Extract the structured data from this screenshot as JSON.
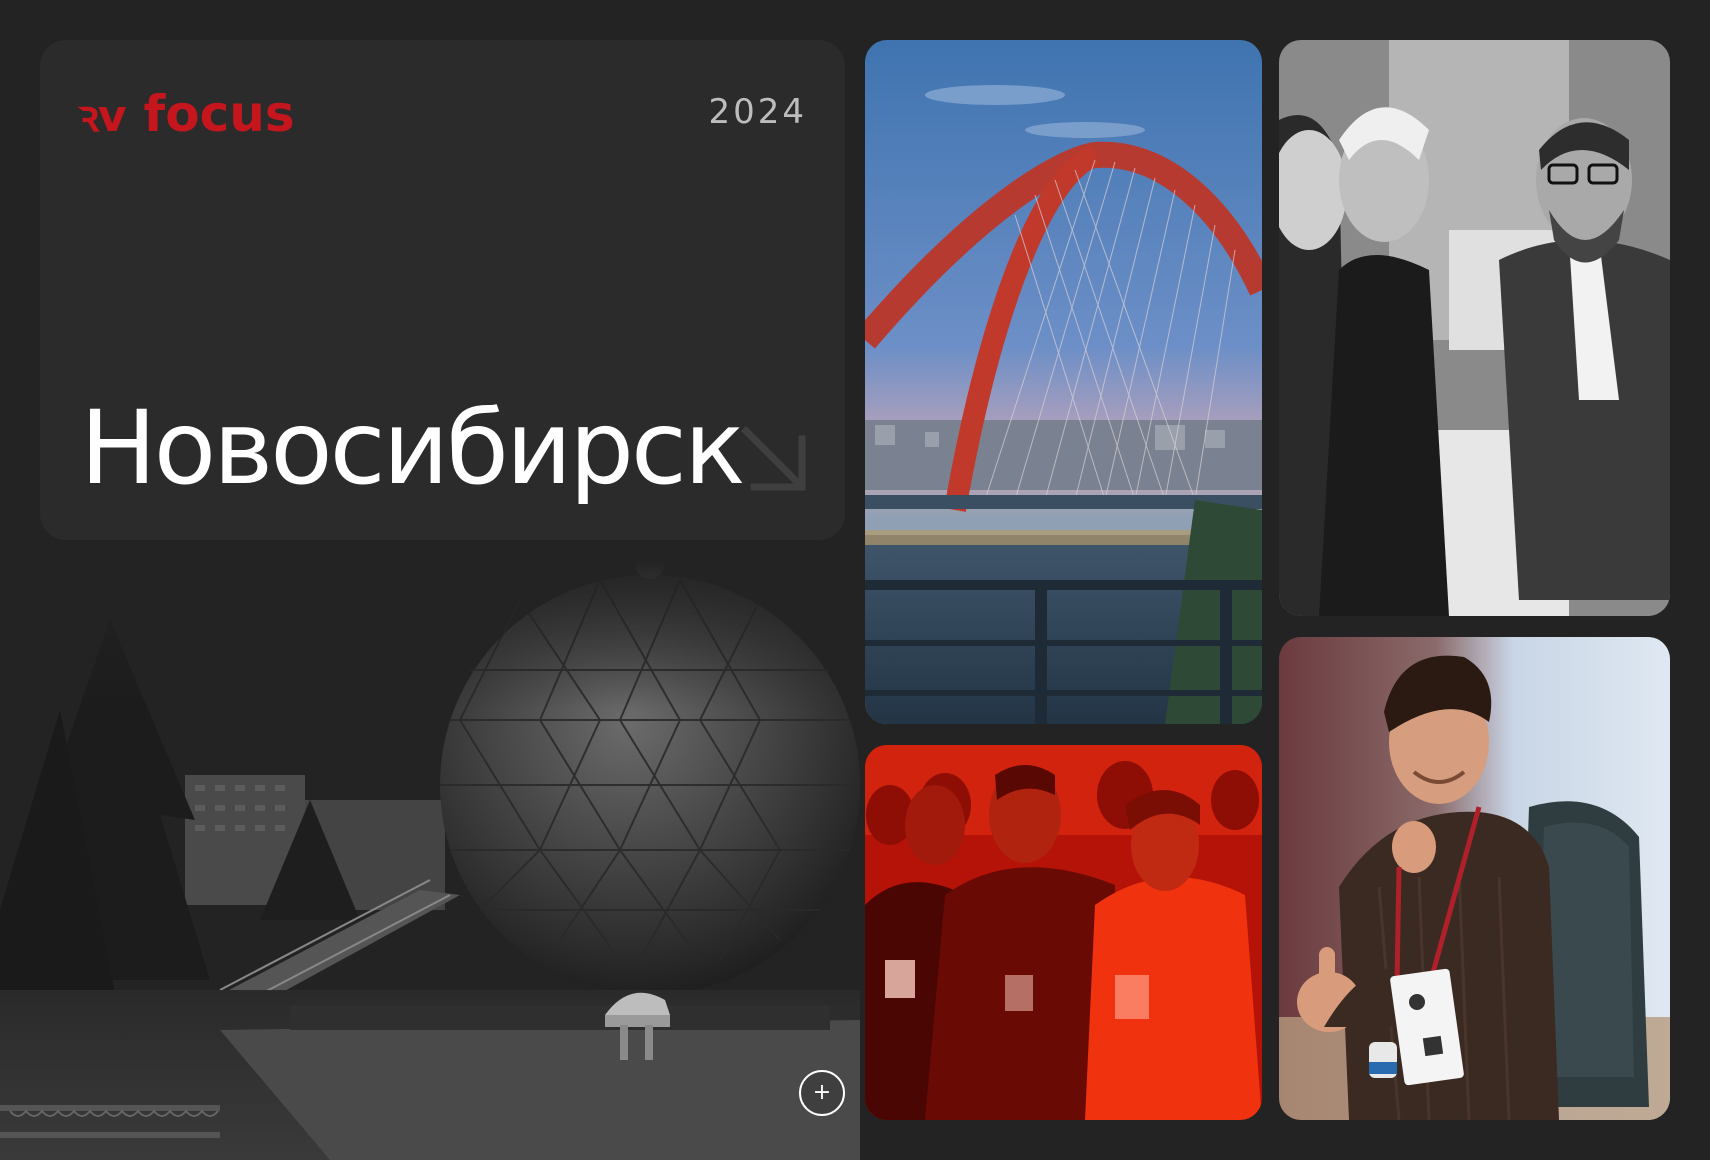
{
  "brand": {
    "mark": "ꝛv",
    "word": "focus",
    "color": "#c4161c"
  },
  "hero": {
    "year": "2024",
    "city": "Новосибирск"
  },
  "icons": {
    "arrow": "arrow-down-right-icon",
    "plus": "plus-icon"
  },
  "controls": {
    "plus_label": "+"
  },
  "colors": {
    "background": "#232323",
    "card": "#2b2b2b",
    "accent": "#c4161c"
  }
}
